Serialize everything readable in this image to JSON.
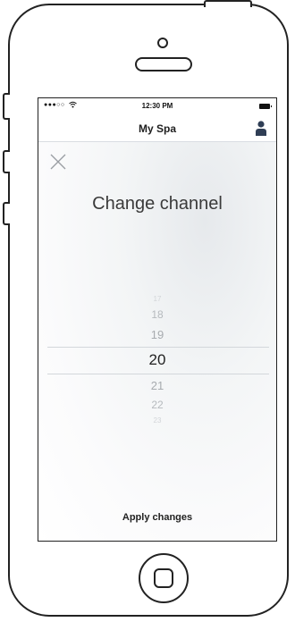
{
  "status_bar": {
    "signal": "●●●○○",
    "time": "12:30 PM"
  },
  "nav": {
    "title": "My Spa"
  },
  "modal": {
    "title": "Change channel",
    "apply_label": "Apply changes"
  },
  "picker": {
    "items": [
      "17",
      "18",
      "19",
      "20",
      "21",
      "22",
      "23"
    ],
    "selected": "20"
  },
  "icons": {
    "wifi": "wifi-icon",
    "battery": "battery-icon",
    "profile": "profile-icon",
    "close": "close-icon"
  },
  "colors": {
    "text": "#3a3a3a",
    "divider": "#d3d7db",
    "profile": "#2f3e55"
  }
}
